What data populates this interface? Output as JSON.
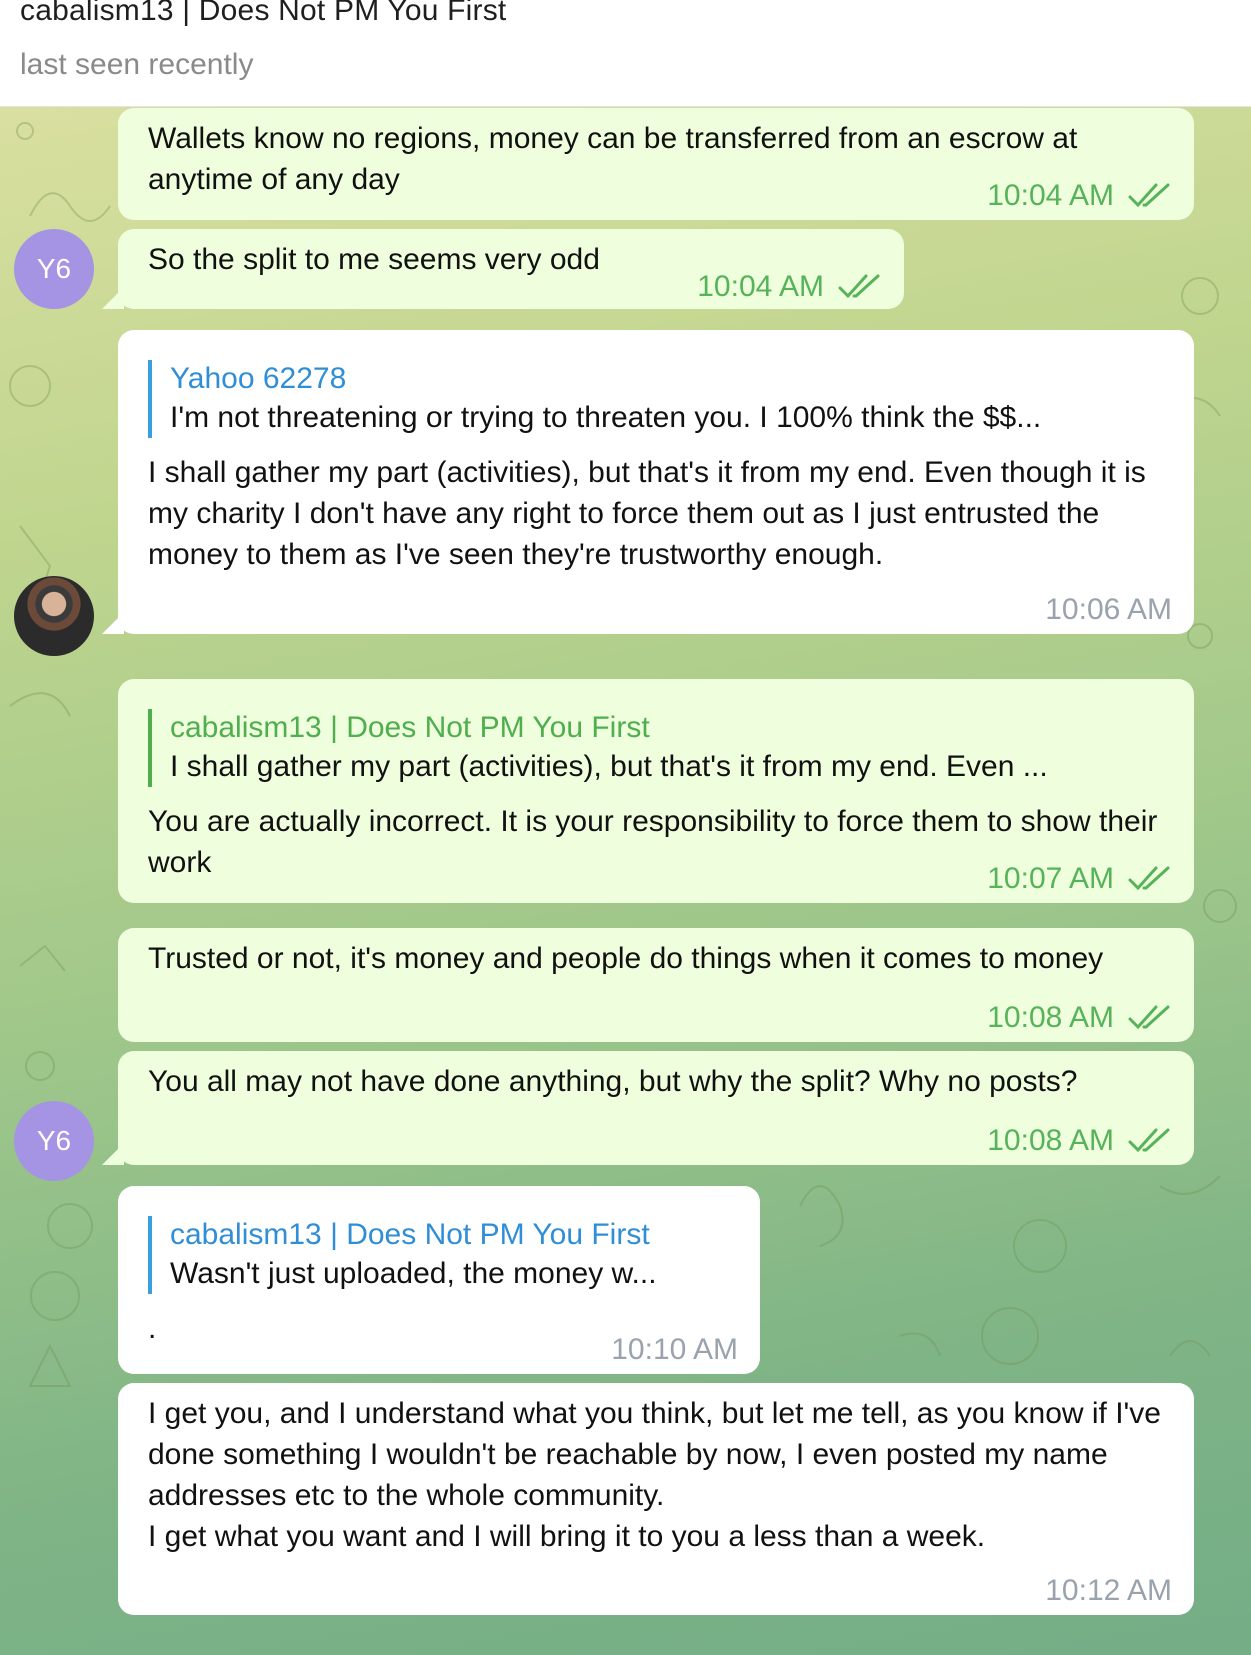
{
  "header": {
    "title": "cabalism13 | Does Not PM You First",
    "status": "last seen recently"
  },
  "messages": [
    {
      "text": "Wallets know no regions, money can be transferred from an escrow at anytime of any day",
      "time": "10:04 AM"
    },
    {
      "avatar": "Y6",
      "text": "So the split to me seems very odd",
      "time": "10:04 AM"
    },
    {
      "quote_name": "Yahoo 62278",
      "quote_text": "I'm not threatening or trying to threaten you. I 100% think the $$...",
      "text": "I shall gather my part (activities), but that's it from my end. Even though it is my charity I don't have any right to force them out as I just entrusted the money to them as I've seen they're trustworthy enough.",
      "time": "10:06 AM"
    },
    {
      "quote_name": "cabalism13 | Does Not PM You First",
      "quote_text": "I shall gather my part (activities), but that's it from my end. Even ...",
      "text": "You are actually incorrect. It is your responsibility to force them to show their work",
      "time": "10:07 AM"
    },
    {
      "text": "Trusted or not, it's money and people do things when it comes to money",
      "time": "10:08 AM"
    },
    {
      "avatar": "Y6",
      "text": "You all may not have done anything, but why the split? Why no posts?",
      "time": "10:08 AM"
    },
    {
      "quote_name": "cabalism13 | Does Not PM You First",
      "quote_text": "Wasn't just uploaded, the money w...",
      "text": ".",
      "time": "10:10 AM"
    },
    {
      "text_lines": [
        "I get you, and I understand what you think, but let me tell, as you know if I've done something I wouldn't be reachable by now, I even posted my name addresses etc to the whole community.",
        "I get what you want and I will bring it to you a less than a week."
      ],
      "time": "10:12 AM"
    }
  ],
  "icons": {
    "read_receipt": "double-check-icon",
    "avatar_photo": "user-photo-avatar"
  },
  "colors": {
    "outgoing_bubble": "#effedd",
    "incoming_bubble": "#ffffff",
    "outgoing_time": "#56b35a",
    "incoming_time": "#9aa3ad",
    "avatar_y6": "#a594e4",
    "quote_blue": "#2f8ed6",
    "quote_green": "#4fae4e"
  }
}
